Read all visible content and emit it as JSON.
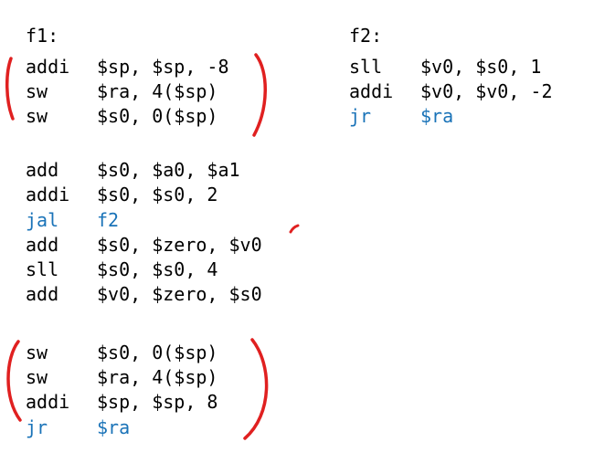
{
  "f1": {
    "label": "f1:",
    "lines": [
      {
        "op": "addi",
        "args": "$sp, $sp, -8",
        "blue": false
      },
      {
        "op": "sw",
        "args": "$ra, 4($sp)",
        "blue": false
      },
      {
        "op": "sw",
        "args": "$s0, 0($sp)",
        "blue": false
      },
      {
        "op": "add",
        "args": "$s0, $a0, $a1",
        "blue": false
      },
      {
        "op": "addi",
        "args": "$s0, $s0, 2",
        "blue": false
      },
      {
        "op": "jal",
        "args": "f2",
        "blue": true
      },
      {
        "op": "add",
        "args": "$s0, $zero, $v0",
        "blue": false
      },
      {
        "op": "sll",
        "args": "$s0, $s0, 4",
        "blue": false
      },
      {
        "op": "add",
        "args": "$v0, $zero, $s0",
        "blue": false
      },
      {
        "op": "sw",
        "args": "$s0, 0($sp)",
        "blue": false
      },
      {
        "op": "sw",
        "args": "$ra, 4($sp)",
        "blue": false
      },
      {
        "op": "addi",
        "args": "$sp, $sp, 8",
        "blue": false
      },
      {
        "op": "jr",
        "args": "$ra",
        "blue": true
      }
    ]
  },
  "f2": {
    "label": "f2:",
    "lines": [
      {
        "op": "sll",
        "args": "$v0, $s0, 1",
        "blue": false
      },
      {
        "op": "addi",
        "args": "$v0, $v0, -2",
        "blue": false
      },
      {
        "op": "jr",
        "args": "$ra",
        "blue": true
      }
    ]
  },
  "colors": {
    "text": "#000000",
    "keyword_blue": "#1a73b8",
    "annotation_red": "#e02020"
  }
}
